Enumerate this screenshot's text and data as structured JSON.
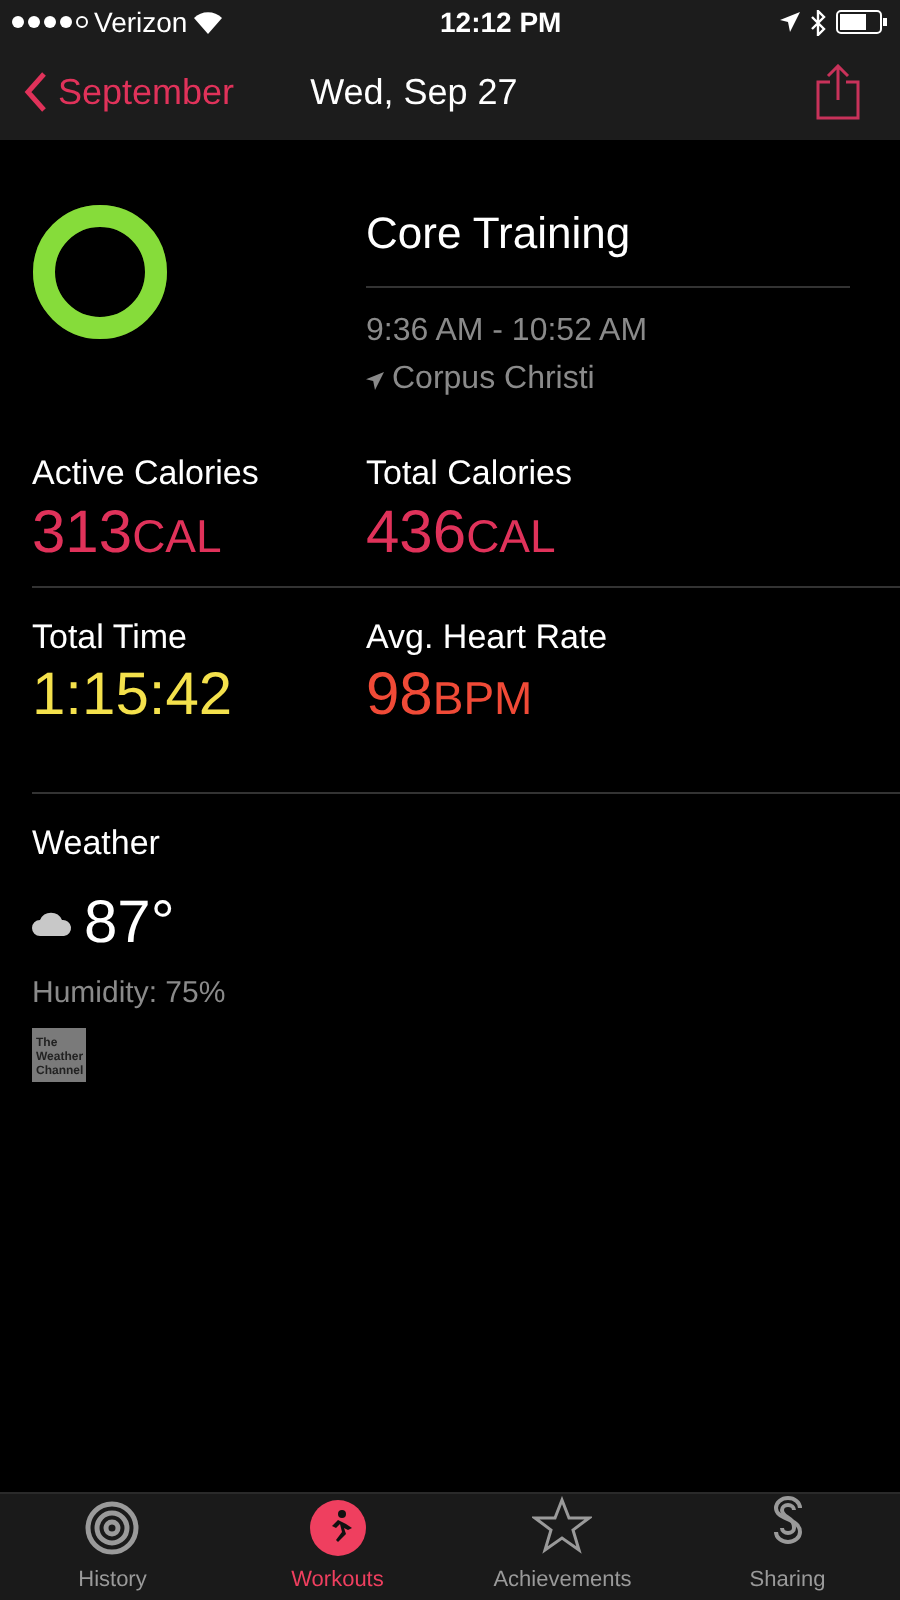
{
  "status_bar": {
    "signal_dots": [
      {
        "on": true
      },
      {
        "on": true
      },
      {
        "on": true
      },
      {
        "on": true
      },
      {
        "on": false
      }
    ],
    "carrier": "Verizon",
    "time": "12:12 PM"
  },
  "nav": {
    "back": "September",
    "title": "Wed, Sep 27"
  },
  "workout": {
    "ring": {
      "level": 1
    },
    "name": "Core Training",
    "time_range": "9:36 AM - 10:52 AM",
    "location": "Corpus Christi"
  },
  "metrics": [
    {
      "label": "Active Calories",
      "value": "313",
      "unit": "CAL",
      "color": "#e0325a"
    },
    {
      "label": "Total Calories",
      "value": "436",
      "unit": "CAL",
      "color": "#e0325a"
    },
    {
      "label": "Total Time",
      "value": "1:15:42",
      "color": "#f4e14c"
    },
    {
      "label": "Avg. Heart Rate",
      "value": "98",
      "unit": "BPM",
      "color": "#f04a37"
    }
  ],
  "weather": {
    "title": "Weather",
    "temperature": "87°",
    "humidity": "Humidity: 75%",
    "source_logo": "The Weather Channel"
  },
  "tabs": [
    {
      "kind": "history",
      "label": "History",
      "selected": false
    },
    {
      "kind": "workouts",
      "label": "Workouts",
      "selected": true
    },
    {
      "kind": "achievements",
      "label": "Achievements",
      "selected": false
    },
    {
      "kind": "sharing",
      "label": "Sharing",
      "selected": false
    }
  ]
}
